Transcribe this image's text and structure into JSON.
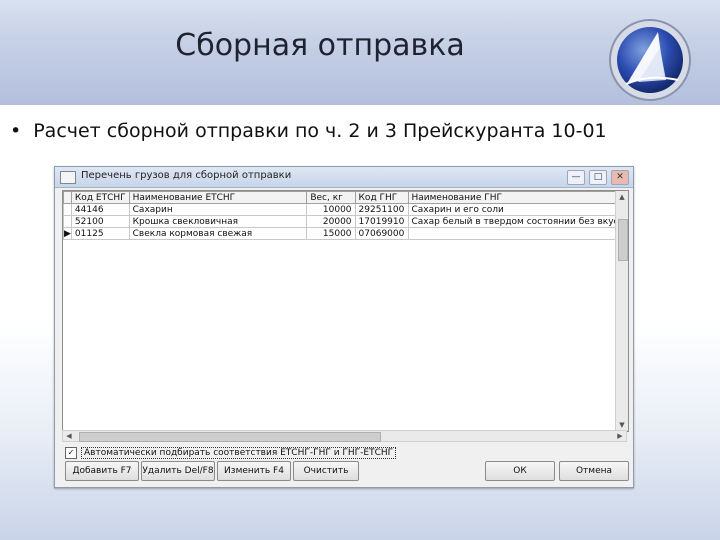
{
  "slide": {
    "title": "Сборная отправка",
    "bullet": "Расчет сборной отправки по ч. 2 и 3 Прейскуранта 10-01"
  },
  "window": {
    "title": "Перечень грузов для сборной отправки",
    "controls": {
      "minimize": "—",
      "maximize": "□",
      "close": "✕"
    }
  },
  "table": {
    "columns": [
      "Код ЕТСНГ",
      "Наименование ЕТСНГ",
      "Вес, кг",
      "Код ГНГ",
      "Наименование ГНГ"
    ],
    "rows": [
      {
        "indicator": "",
        "code": "44146",
        "name": "Сахарин",
        "weight": "10000",
        "gng": "29251100",
        "gng_name": "Сахарин и его соли"
      },
      {
        "indicator": "",
        "code": "52100",
        "name": "Крошка свекловичная",
        "weight": "20000",
        "gng": "17019910",
        "gng_name": "Сахар белый в твердом состоянии без вкусо"
      },
      {
        "indicator": "▶",
        "code": "01125",
        "name": "Свекла кормовая свежая",
        "weight": "15000",
        "gng": "07069000",
        "gng_name": ""
      }
    ]
  },
  "checkbox": {
    "checked": "✓",
    "label": "Автоматически подбирать соответствия ЕТСНГ-ГНГ и ГНГ-ЕТСНГ"
  },
  "buttons": {
    "add": "Добавить F7",
    "delete": "Удалить Del/F8",
    "change": "Изменить F4",
    "clear": "Очистить",
    "ok": "ОК",
    "cancel": "Отмена"
  },
  "colors": {
    "banner": "#c6d0e6",
    "logo_ring": "#2b3f8f"
  }
}
